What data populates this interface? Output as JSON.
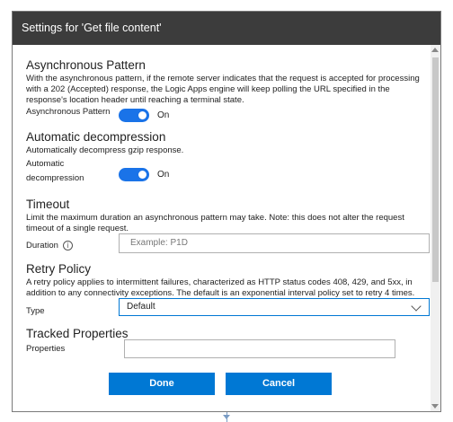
{
  "dialog": {
    "title": "Settings for 'Get file content'"
  },
  "async": {
    "title": "Asynchronous Pattern",
    "description": "With the asynchronous pattern, if the remote server indicates that the request is accepted for processing with a 202 (Accepted) response, the Logic Apps engine will keep polling the URL specified in the response's location header until reaching a terminal state.",
    "toggle_label": "Asynchronous Pattern",
    "state": "On"
  },
  "decompression": {
    "title": "Automatic decompression",
    "description": "Automatically decompress gzip response.",
    "toggle_label_line1": "Automatic",
    "toggle_label_line2": "decompression",
    "state": "On"
  },
  "timeout": {
    "title": "Timeout",
    "description": "Limit the maximum duration an asynchronous pattern may take. Note: this does not alter the request timeout of a single request.",
    "field_label": "Duration",
    "placeholder": "Example: P1D"
  },
  "retry": {
    "title": "Retry Policy",
    "description": "A retry policy applies to intermittent failures, characterized as HTTP status codes 408, 429, and 5xx, in addition to any connectivity exceptions. The default is an exponential interval policy set to retry 4 times.",
    "field_label": "Type",
    "selected": "Default"
  },
  "tracked": {
    "title": "Tracked Properties",
    "field_label": "Properties",
    "value": ""
  },
  "buttons": {
    "done": "Done",
    "cancel": "Cancel"
  },
  "colors": {
    "header_bg": "#3c3c3c",
    "accent": "#0078d4",
    "toggle_on": "#1a73e8"
  }
}
